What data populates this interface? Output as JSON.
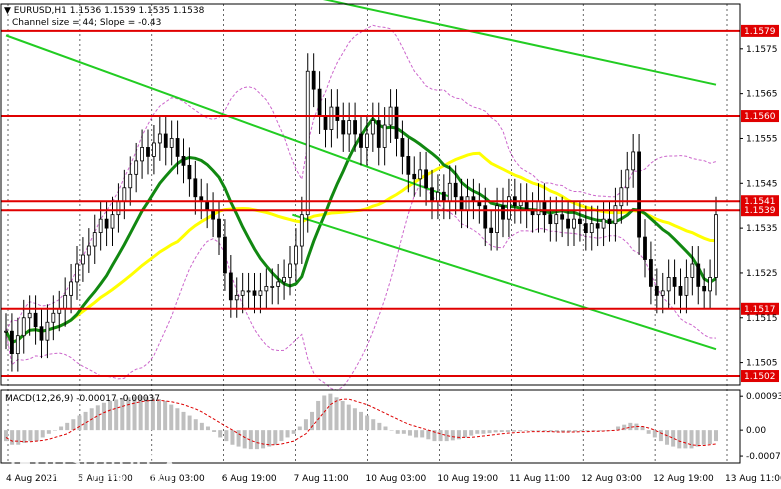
{
  "header": {
    "symbol_line": "EURUSD,H1  1.1536 1.1539 1.1535 1.1538",
    "channel_line": "Channel size = 44; Slope = -0.43",
    "macd_label": "MACD(12,26,9) -0.00017 -0.00037"
  },
  "watermark": {
    "brand": "instaforex",
    "tagline": "Instant Forex Trading"
  },
  "colors": {
    "level_line": "#e00000",
    "ma_fast": "#118811",
    "ma_slow": "#ffff00",
    "channel": "#22cc22",
    "bollinger": "#cc66cc",
    "candle": "#000000",
    "macd_hist": "#bfbfbf",
    "macd_signal": "#dd0000"
  },
  "chart_data": [
    {
      "type": "candlestick",
      "title": "EURUSD,H1",
      "ylim": [
        1.15,
        1.1585
      ],
      "y_ticks": [
        "1.1575",
        "1.1565",
        "1.1555",
        "1.1545",
        "1.1535",
        "1.1525",
        "1.1515",
        "1.1505"
      ],
      "y_tick_values": [
        1.1575,
        1.1565,
        1.1555,
        1.1545,
        1.1535,
        1.1525,
        1.1515,
        1.1505
      ],
      "x_ticks": [
        "4 Aug 2021",
        "5 Aug 11:00",
        "6 Aug 03:00",
        "6 Aug 19:00",
        "7 Aug 11:00",
        "10 Aug 03:00",
        "10 Aug 19:00",
        "11 Aug 11:00",
        "12 Aug 03:00",
        "12 Aug 19:00",
        "13 Aug 11:00"
      ],
      "levels": [
        {
          "label": "1.1579",
          "value": 1.1579
        },
        {
          "label": "1.1560",
          "value": 1.156
        },
        {
          "label": "1.1541",
          "value": 1.1541
        },
        {
          "label": "1.1539",
          "value": 1.1539
        },
        {
          "label": "1.1517",
          "value": 1.1517
        },
        {
          "label": "1.1502",
          "value": 1.1502
        }
      ],
      "close": [
        1.1512,
        1.1507,
        1.1511,
        1.1515,
        1.1516,
        1.1513,
        1.151,
        1.1514,
        1.1516,
        1.1517,
        1.152,
        1.1523,
        1.1527,
        1.1529,
        1.1531,
        1.1534,
        1.1537,
        1.1535,
        1.1538,
        1.1541,
        1.1544,
        1.1547,
        1.155,
        1.1553,
        1.1551,
        1.1554,
        1.1556,
        1.1553,
        1.1555,
        1.1551,
        1.1549,
        1.1546,
        1.1542,
        1.1541,
        1.1539,
        1.1537,
        1.1533,
        1.1525,
        1.1519,
        1.152,
        1.1521,
        1.1521,
        1.152,
        1.1521,
        1.1522,
        1.1522,
        1.1523,
        1.1524,
        1.1527,
        1.1531,
        1.1538,
        1.157,
        1.1566,
        1.156,
        1.1557,
        1.1562,
        1.1559,
        1.1556,
        1.1559,
        1.1556,
        1.1553,
        1.1556,
        1.1559,
        1.1553,
        1.1558,
        1.1562,
        1.1555,
        1.1551,
        1.1547,
        1.1546,
        1.1548,
        1.1544,
        1.1541,
        1.1543,
        1.1541,
        1.1545,
        1.1542,
        1.1539,
        1.1542,
        1.1541,
        1.154,
        1.1535,
        1.1534,
        1.154,
        1.1537,
        1.1542,
        1.154,
        1.1541,
        1.1539,
        1.1538,
        1.1541,
        1.1538,
        1.1536,
        1.1538,
        1.1537,
        1.1535,
        1.1537,
        1.1536,
        1.1534,
        1.1536,
        1.1535,
        1.1537,
        1.1536,
        1.154,
        1.1544,
        1.1548,
        1.1552,
        1.1533,
        1.1528,
        1.1522,
        1.152,
        1.1521,
        1.1524,
        1.1522,
        1.152,
        1.1524,
        1.1527,
        1.1522,
        1.1521,
        1.1524,
        1.1538
      ]
    },
    {
      "type": "bar",
      "title": "MACD(12,26,9)",
      "ylim": [
        -0.0009,
        0.0011
      ],
      "y_ticks": [
        "0.00093",
        "0.00",
        "-0.00071"
      ],
      "y_tick_values": [
        0.00093,
        0.0,
        -0.00071
      ],
      "series": [
        {
          "name": "MACD",
          "values": [
            -0.0003,
            -0.0004,
            -0.0004,
            -0.00035,
            -0.0003,
            -0.0003,
            -0.0002,
            -0.0001,
            0.0,
            0.0001,
            0.0002,
            0.0003,
            0.0004,
            0.0005,
            0.0006,
            0.00068,
            0.00075,
            0.0008,
            0.00084,
            0.00088,
            0.0009,
            0.00092,
            0.00093,
            0.00092,
            0.0009,
            0.00085,
            0.0008,
            0.0007,
            0.0006,
            0.0005,
            0.0004,
            0.0003,
            0.0002,
            0.0001,
            -5e-05,
            -0.0002,
            -0.0003,
            -0.0004,
            -0.00045,
            -0.0005,
            -0.00052,
            -0.00052,
            -0.0005,
            -0.00045,
            -0.0004,
            -0.0003,
            -0.0002,
            -0.0001,
            0.0001,
            0.0003,
            0.0005,
            0.0008,
            0.00095,
            0.001,
            0.0009,
            0.0008,
            0.0007,
            0.0006,
            0.0005,
            0.0004,
            0.0003,
            0.0002,
            0.0001,
            0.0,
            -0.0001,
            -0.0001,
            -0.00015,
            -0.0002,
            -0.0002,
            -0.00025,
            -0.0003,
            -0.0003,
            -0.0003,
            -0.00028,
            -0.00025,
            -0.0002,
            -0.00015,
            -0.0001,
            -0.0001,
            -8e-05,
            -6e-05,
            -5e-05,
            -5e-05,
            -4e-05,
            -3e-05,
            -2e-05,
            -2e-05,
            -2e-05,
            -3e-05,
            -4e-05,
            -5e-05,
            -6e-05,
            -5e-05,
            -4e-05,
            -3e-05,
            -3e-05,
            -2e-05,
            -2e-05,
            -1e-05,
            0.0,
            0.0001,
            0.00015,
            0.0002,
            0.00018,
            0.0001,
            -0.0001,
            -0.0002,
            -0.0003,
            -0.0004,
            -0.00045,
            -0.0005,
            -0.0005,
            -0.0005,
            -0.00045,
            -0.0004,
            -0.00038,
            -0.0003
          ]
        },
        {
          "name": "Signal",
          "values": [
            -0.0002,
            -0.0003,
            -0.0003,
            -0.00032,
            -0.00032,
            -0.0003,
            -0.00028,
            -0.00025,
            -0.0002,
            -0.00015,
            -0.0001,
            0.0,
            0.0001,
            0.0002,
            0.0003,
            0.0004,
            0.00048,
            0.00055,
            0.0006,
            0.00065,
            0.0007,
            0.00074,
            0.00078,
            0.0008,
            0.00082,
            0.00082,
            0.0008,
            0.00078,
            0.00074,
            0.0007,
            0.00064,
            0.00058,
            0.0005,
            0.0004,
            0.0003,
            0.0002,
            0.0001,
            0.0,
            -0.0001,
            -0.0002,
            -0.00028,
            -0.00034,
            -0.00038,
            -0.0004,
            -0.0004,
            -0.00038,
            -0.00034,
            -0.0003,
            -0.0002,
            -0.0001,
            0.0001,
            0.0003,
            0.0005,
            0.0007,
            0.0008,
            0.00085,
            0.00085,
            0.0008,
            0.00075,
            0.0007,
            0.00062,
            0.00054,
            0.00046,
            0.00038,
            0.0003,
            0.00022,
            0.00015,
            0.0001,
            5e-05,
            0.0,
            -5e-05,
            -0.0001,
            -0.00015,
            -0.00018,
            -0.0002,
            -0.0002,
            -0.0002,
            -0.00018,
            -0.00016,
            -0.00014,
            -0.00012,
            -0.0001,
            -8e-05,
            -7e-05,
            -6e-05,
            -5e-05,
            -4e-05,
            -4e-05,
            -4e-05,
            -4e-05,
            -5e-05,
            -5e-05,
            -5e-05,
            -5e-05,
            -4e-05,
            -4e-05,
            -3e-05,
            -3e-05,
            -2e-05,
            -1e-05,
            0.0,
            4e-05,
            8e-05,
            0.0001,
            0.0001,
            6e-05,
            0.0,
            -8e-05,
            -0.00015,
            -0.00022,
            -0.0003,
            -0.00035,
            -0.0004,
            -0.00042,
            -0.00042,
            -0.0004,
            -0.00038
          ]
        }
      ]
    }
  ]
}
